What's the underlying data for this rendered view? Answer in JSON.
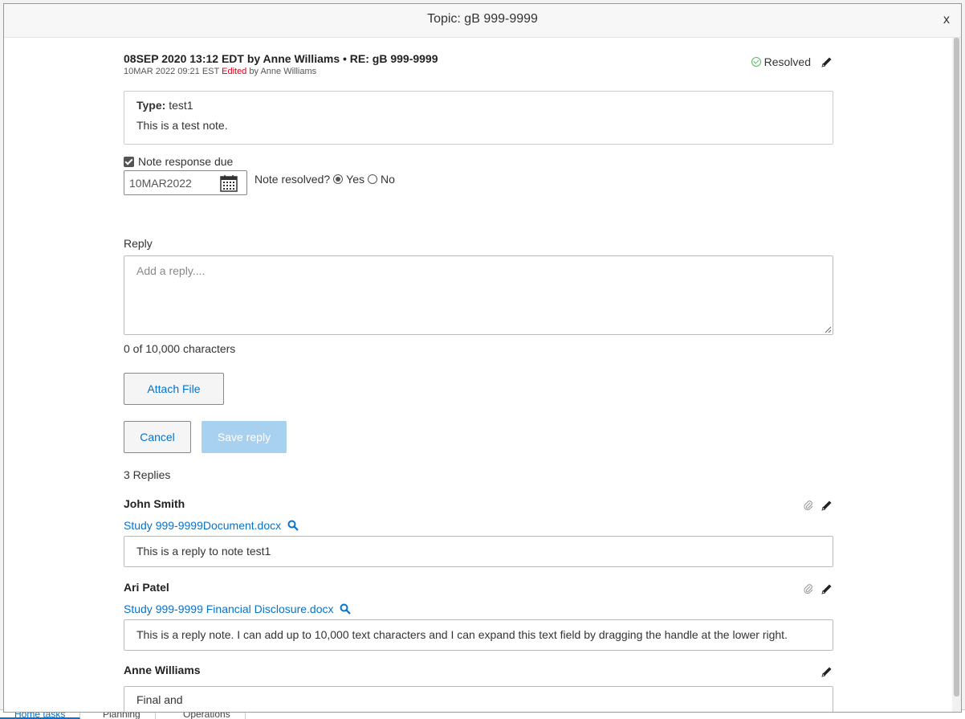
{
  "modal": {
    "title": "Topic: gB 999-9999",
    "close_label": "x"
  },
  "note": {
    "title": "08SEP 2020 13:12 EDT by Anne Williams • RE: gB 999-9999",
    "edited_date": "10MAR 2022 09:21 EST",
    "edited_label": "Edited",
    "edited_by": "by Anne Williams",
    "status": "Resolved",
    "type_label": "Type:",
    "type_value": "test1",
    "text": "This is a test note."
  },
  "response": {
    "due_label": "Note response due",
    "due_checked": true,
    "due_date": "10MAR2022",
    "resolved_question": "Note resolved?",
    "yes_label": "Yes",
    "no_label": "No",
    "resolved_value": "Yes"
  },
  "reply_form": {
    "label": "Reply",
    "placeholder": "Add a reply....",
    "char_count": "0 of 10,000 characters",
    "attach_label": "Attach File",
    "cancel_label": "Cancel",
    "save_label": "Save reply"
  },
  "replies": {
    "count_label": "3 Replies",
    "items": [
      {
        "author": "John Smith",
        "attachment": "Study 999-9999Document.docx",
        "text": "This is a reply to note test1"
      },
      {
        "author": "Ari Patel",
        "attachment": "Study 999-9999 Financial Disclosure.docx",
        "text": "This is a reply note. I can add up to 10,000 text characters and I can expand this text field by dragging the handle at the lower right."
      },
      {
        "author": "Anne Williams",
        "text": "Final and"
      }
    ]
  },
  "background_tabs": [
    "Home tasks",
    "Planning",
    "Operations"
  ],
  "colors": {
    "link": "#0572ce",
    "resolved_check": "#5cb85c",
    "edited": "#d0021b",
    "save_disabled": "#a8d1ef"
  }
}
